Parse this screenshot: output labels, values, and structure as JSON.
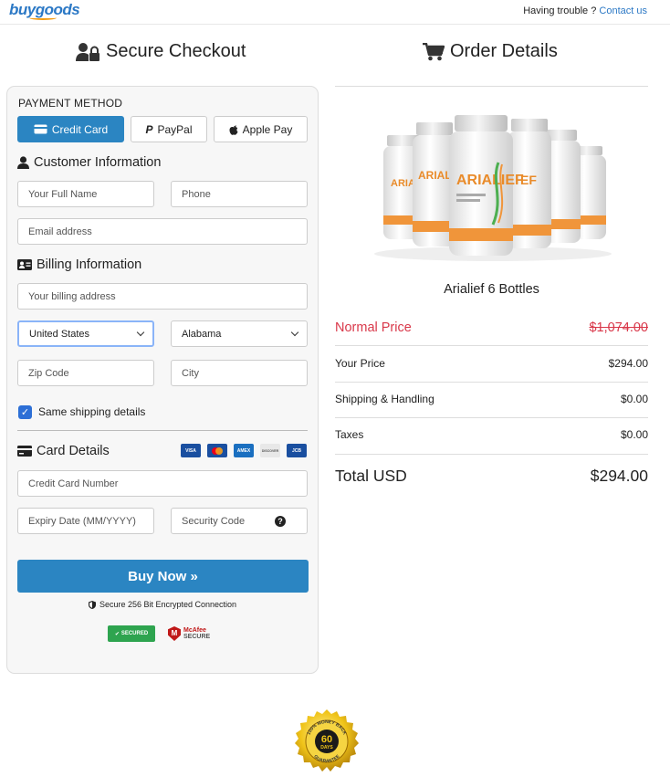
{
  "header": {
    "logo": "buygoods",
    "trouble_text": "Having trouble ? ",
    "contact_link": "Contact us"
  },
  "checkout": {
    "title": "Secure Checkout",
    "payment_method_label": "PAYMENT METHOD",
    "methods": [
      "Credit Card",
      "PayPal",
      "Apple Pay"
    ],
    "customer_info_title": "Customer Information",
    "full_name_placeholder": "Your Full Name",
    "phone_placeholder": "Phone",
    "email_placeholder": "Email address",
    "billing_info_title": "Billing Information",
    "billing_address_placeholder": "Your billing address",
    "country_value": "United States",
    "state_value": "Alabama",
    "zip_placeholder": "Zip Code",
    "city_placeholder": "City",
    "same_shipping_label": "Same shipping details",
    "same_shipping_checked": true,
    "card_details_title": "Card Details",
    "card_brands": [
      "VISA",
      "MC",
      "AMEX",
      "DISCOVER",
      "JCB"
    ],
    "card_number_placeholder": "Credit Card Number",
    "expiry_placeholder": "Expiry Date (MM/YYYY)",
    "security_code_placeholder": "Security Code",
    "buy_button": "Buy Now »",
    "secure_text": "Secure 256 Bit Encrypted Connection",
    "badge_secured": "SECURED",
    "badge_mcafee_1": "McAfee",
    "badge_mcafee_2": "SECURE"
  },
  "order": {
    "title": "Order Details",
    "product_name": "Arialief 6 Bottles",
    "bottle_label": "ARIALIEF",
    "normal_price_label": "Normal Price",
    "normal_price": "$1,074.00",
    "your_price_label": "Your Price",
    "your_price": "$294.00",
    "shipping_label": "Shipping & Handling",
    "shipping": "$0.00",
    "taxes_label": "Taxes",
    "taxes": "$0.00",
    "total_label": "Total USD",
    "total": "$294.00"
  },
  "guarantee": {
    "top": "100% MONEY BACK",
    "number": "60",
    "unit": "DAYS",
    "bottom": "GUARANTEE"
  },
  "colors": {
    "brand_blue": "#2b85c2",
    "price_red": "#d9384a",
    "checkbox_blue": "#2d6fd6"
  }
}
